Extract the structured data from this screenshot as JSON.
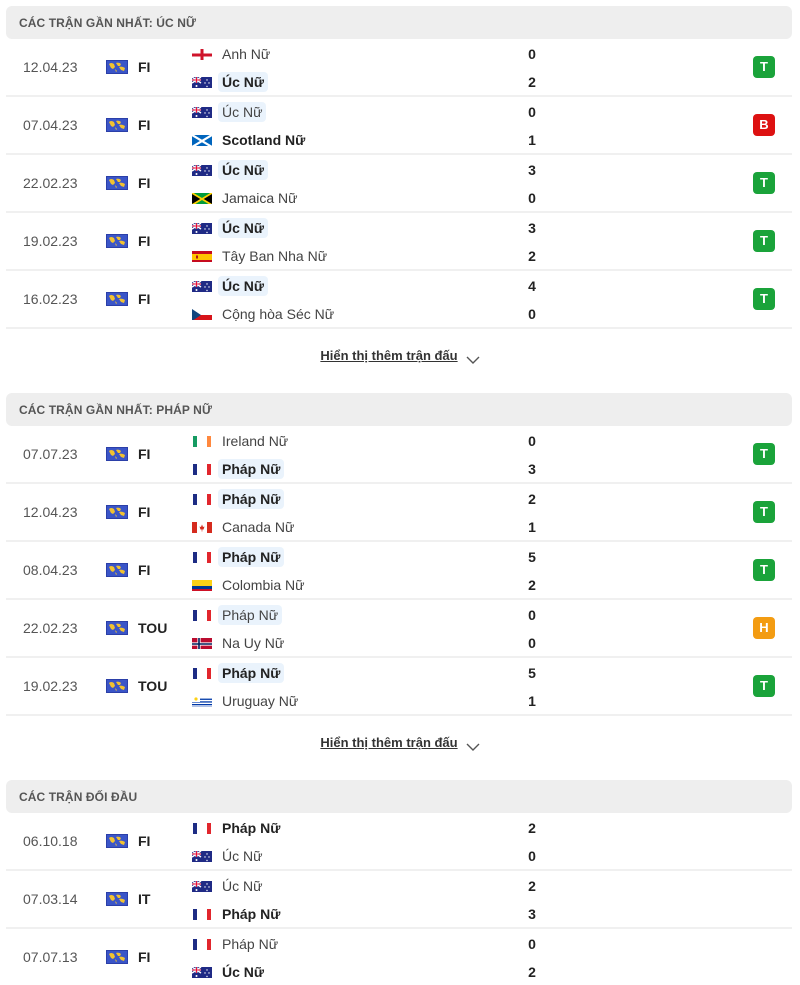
{
  "colors": {
    "win": "#1aa33a",
    "loss": "#dd1111",
    "draw": "#f39c12",
    "focus_bg": "#eaf3fc",
    "header_bg": "#eeeeee"
  },
  "sections": [
    {
      "title": "CÁC TRẬN GẦN NHẤT: ÚC NỮ",
      "show_more": "Hiển thị thêm trận đấu",
      "matches": [
        {
          "date": "12.04.23",
          "comp": "FI",
          "home": {
            "name": "Anh Nữ",
            "flag": "england",
            "score": "0",
            "bold": false,
            "focus": false
          },
          "away": {
            "name": "Úc Nữ",
            "flag": "australia",
            "score": "2",
            "bold": true,
            "focus": true
          },
          "result": "T",
          "result_type": "win"
        },
        {
          "date": "07.04.23",
          "comp": "FI",
          "home": {
            "name": "Úc Nữ",
            "flag": "australia",
            "score": "0",
            "bold": false,
            "focus": true
          },
          "away": {
            "name": "Scotland Nữ",
            "flag": "scotland",
            "score": "1",
            "bold": true,
            "focus": false
          },
          "result": "B",
          "result_type": "loss"
        },
        {
          "date": "22.02.23",
          "comp": "FI",
          "home": {
            "name": "Úc Nữ",
            "flag": "australia",
            "score": "3",
            "bold": true,
            "focus": true
          },
          "away": {
            "name": "Jamaica Nữ",
            "flag": "jamaica",
            "score": "0",
            "bold": false,
            "focus": false
          },
          "result": "T",
          "result_type": "win"
        },
        {
          "date": "19.02.23",
          "comp": "FI",
          "home": {
            "name": "Úc Nữ",
            "flag": "australia",
            "score": "3",
            "bold": true,
            "focus": true
          },
          "away": {
            "name": "Tây Ban Nha Nữ",
            "flag": "spain",
            "score": "2",
            "bold": false,
            "focus": false
          },
          "result": "T",
          "result_type": "win"
        },
        {
          "date": "16.02.23",
          "comp": "FI",
          "home": {
            "name": "Úc Nữ",
            "flag": "australia",
            "score": "4",
            "bold": true,
            "focus": true
          },
          "away": {
            "name": "Cộng hòa Séc Nữ",
            "flag": "czech",
            "score": "0",
            "bold": false,
            "focus": false
          },
          "result": "T",
          "result_type": "win"
        }
      ]
    },
    {
      "title": "CÁC TRẬN GẦN NHẤT: PHÁP NỮ",
      "show_more": "Hiển thị thêm trận đấu",
      "matches": [
        {
          "date": "07.07.23",
          "comp": "FI",
          "home": {
            "name": "Ireland Nữ",
            "flag": "ireland",
            "score": "0",
            "bold": false,
            "focus": false
          },
          "away": {
            "name": "Pháp Nữ",
            "flag": "france",
            "score": "3",
            "bold": true,
            "focus": true
          },
          "result": "T",
          "result_type": "win"
        },
        {
          "date": "12.04.23",
          "comp": "FI",
          "home": {
            "name": "Pháp Nữ",
            "flag": "france",
            "score": "2",
            "bold": true,
            "focus": true
          },
          "away": {
            "name": "Canada Nữ",
            "flag": "canada",
            "score": "1",
            "bold": false,
            "focus": false
          },
          "result": "T",
          "result_type": "win"
        },
        {
          "date": "08.04.23",
          "comp": "FI",
          "home": {
            "name": "Pháp Nữ",
            "flag": "france",
            "score": "5",
            "bold": true,
            "focus": true
          },
          "away": {
            "name": "Colombia Nữ",
            "flag": "colombia",
            "score": "2",
            "bold": false,
            "focus": false
          },
          "result": "T",
          "result_type": "win"
        },
        {
          "date": "22.02.23",
          "comp": "TOU",
          "home": {
            "name": "Pháp Nữ",
            "flag": "france",
            "score": "0",
            "bold": false,
            "focus": true
          },
          "away": {
            "name": "Na Uy Nữ",
            "flag": "norway",
            "score": "0",
            "bold": false,
            "focus": false
          },
          "result": "H",
          "result_type": "draw"
        },
        {
          "date": "19.02.23",
          "comp": "TOU",
          "home": {
            "name": "Pháp Nữ",
            "flag": "france",
            "score": "5",
            "bold": true,
            "focus": true
          },
          "away": {
            "name": "Uruguay Nữ",
            "flag": "uruguay",
            "score": "1",
            "bold": false,
            "focus": false
          },
          "result": "T",
          "result_type": "win"
        }
      ]
    },
    {
      "title": "CÁC TRẬN ĐỐI ĐẦU",
      "show_more": null,
      "matches": [
        {
          "date": "06.10.18",
          "comp": "FI",
          "home": {
            "name": "Pháp Nữ",
            "flag": "france",
            "score": "2",
            "bold": true,
            "focus": false
          },
          "away": {
            "name": "Úc Nữ",
            "flag": "australia",
            "score": "0",
            "bold": false,
            "focus": false
          },
          "result": null,
          "result_type": null
        },
        {
          "date": "07.03.14",
          "comp": "IT",
          "home": {
            "name": "Úc Nữ",
            "flag": "australia",
            "score": "2",
            "bold": false,
            "focus": false
          },
          "away": {
            "name": "Pháp Nữ",
            "flag": "france",
            "score": "3",
            "bold": true,
            "focus": false
          },
          "result": null,
          "result_type": null
        },
        {
          "date": "07.07.13",
          "comp": "FI",
          "home": {
            "name": "Pháp Nữ",
            "flag": "france",
            "score": "0",
            "bold": false,
            "focus": false
          },
          "away": {
            "name": "Úc Nữ",
            "flag": "australia",
            "score": "2",
            "bold": true,
            "focus": false
          },
          "result": null,
          "result_type": null
        }
      ]
    }
  ]
}
